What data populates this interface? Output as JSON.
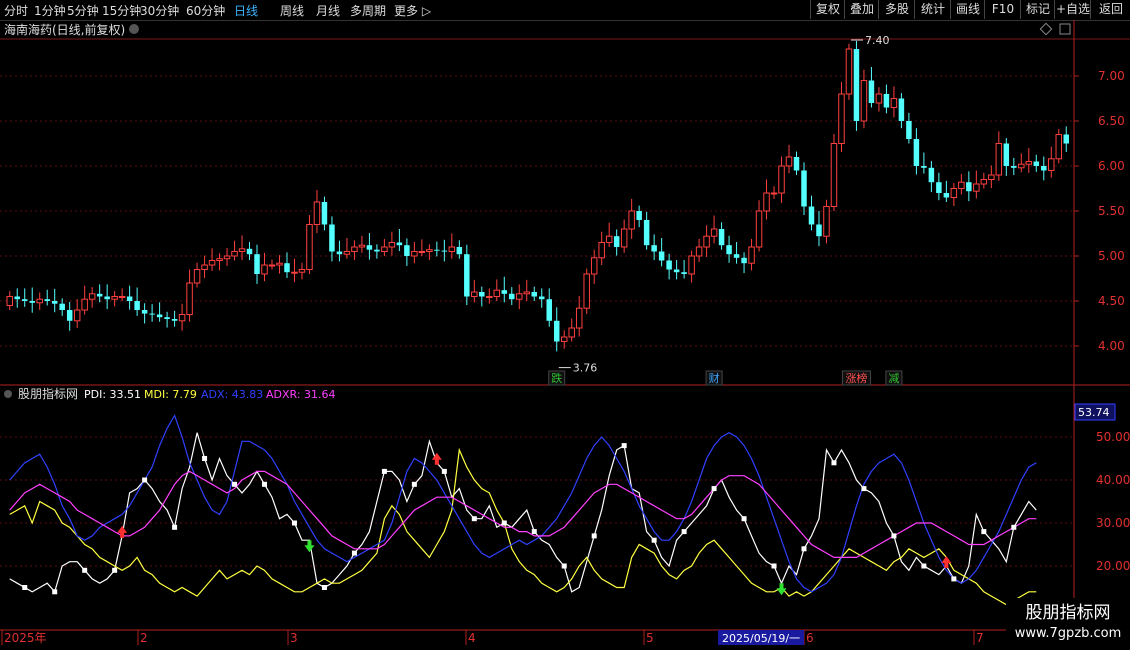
{
  "toolbar": {
    "periods": [
      "分时",
      "1分钟",
      "5分钟",
      "15分钟",
      "30分钟",
      "60分钟",
      "日线",
      "周线",
      "月线",
      "多周期",
      "更多"
    ],
    "active_period": "日线",
    "right_buttons": [
      "复权",
      "叠加",
      "多股",
      "统计",
      "画线",
      "F10",
      "标记",
      "+自选",
      "返回"
    ]
  },
  "price_panel": {
    "title": "海南海药(日线,前复权)",
    "high_label": "7.40",
    "low_label": "3.76",
    "event_tags": [
      {
        "text": "跌",
        "color": "#30c030"
      },
      {
        "text": "财",
        "color": "#3da5ff"
      },
      {
        "text": "涨榜",
        "color": "#ff5050"
      },
      {
        "text": "减",
        "color": "#30c030"
      }
    ],
    "y_ticks": [
      "7.00",
      "6.50",
      "6.00",
      "5.50",
      "5.00",
      "4.50",
      "4.00"
    ],
    "colors": {
      "up": "#ff4040",
      "down": "#54ffff",
      "grid": "#7a1a1a"
    }
  },
  "indicator_panel": {
    "title": "股朋指标网",
    "legend": [
      {
        "text": "PDI: 33.51",
        "color": "#ffffff"
      },
      {
        "text": "MDI: 7.79",
        "color": "#ffff40"
      },
      {
        "text": "ADX: 43.83",
        "color": "#3040ff"
      },
      {
        "text": "ADXR: 31.64",
        "color": "#ff40ff"
      }
    ],
    "y_ticks": [
      "50.00",
      "40.00",
      "30.00",
      "20.00"
    ],
    "current_value": "53.74"
  },
  "date_axis": {
    "labels": [
      "2025年",
      "2",
      "3",
      "4",
      "5",
      "6",
      "7"
    ],
    "cursor_date": "2025/05/19/一"
  },
  "watermark": {
    "title": "股朋指标网",
    "url": "www.7gpzb.com"
  },
  "chart_data": [
    {
      "type": "candlestick",
      "title": "海南海药(日线,前复权)",
      "ylim": [
        3.6,
        7.7
      ],
      "y_ticks": [
        4.0,
        4.5,
        5.0,
        5.5,
        6.0,
        6.5,
        7.0
      ],
      "annotations": [
        {
          "text": "7.40",
          "value": 7.4
        },
        {
          "text": "3.76",
          "value": 3.76
        }
      ],
      "close": [
        4.55,
        4.52,
        4.5,
        4.48,
        4.52,
        4.5,
        4.47,
        4.4,
        4.28,
        4.4,
        4.52,
        4.58,
        4.55,
        4.52,
        4.55,
        4.55,
        4.5,
        4.4,
        4.36,
        4.35,
        4.32,
        4.3,
        4.28,
        4.35,
        4.7,
        4.85,
        4.9,
        4.95,
        4.97,
        5.0,
        5.05,
        5.08,
        5.02,
        4.8,
        4.9,
        4.9,
        4.92,
        4.82,
        4.82,
        4.85,
        5.35,
        5.6,
        5.35,
        5.05,
        5.02,
        5.05,
        5.1,
        5.12,
        5.07,
        5.05,
        5.1,
        5.15,
        5.12,
        5.0,
        5.05,
        5.05,
        5.07,
        5.06,
        5.05,
        5.1,
        5.02,
        4.55,
        4.6,
        4.55,
        4.55,
        4.62,
        4.58,
        4.52,
        4.58,
        4.6,
        4.55,
        4.52,
        4.28,
        4.05,
        4.1,
        4.2,
        4.42,
        4.8,
        4.98,
        5.15,
        5.22,
        5.1,
        5.3,
        5.5,
        5.4,
        5.12,
        5.05,
        4.95,
        4.85,
        4.82,
        4.8,
        5.0,
        5.1,
        5.22,
        5.3,
        5.12,
        5.02,
        4.98,
        4.92,
        5.1,
        5.5,
        5.7,
        5.7,
        6.0,
        6.1,
        5.95,
        5.55,
        5.35,
        5.22,
        5.55,
        6.25,
        6.8,
        7.3,
        6.5,
        6.95,
        6.7,
        6.8,
        6.65,
        6.75,
        6.5,
        6.3,
        6.0,
        5.98,
        5.82,
        5.7,
        5.65,
        5.75,
        5.82,
        5.72,
        5.8,
        5.85,
        5.9,
        6.25,
        6.0,
        5.98,
        6.02,
        6.05,
        6.0,
        5.95,
        6.08,
        6.35,
        6.25
      ],
      "open": [
        4.45,
        4.55,
        4.52,
        4.5,
        4.48,
        4.52,
        4.5,
        4.47,
        4.4,
        4.28,
        4.4,
        4.52,
        4.58,
        4.55,
        4.52,
        4.55,
        4.55,
        4.5,
        4.4,
        4.36,
        4.35,
        4.32,
        4.3,
        4.28,
        4.35,
        4.7,
        4.85,
        4.9,
        4.95,
        4.97,
        5.0,
        5.05,
        5.08,
        5.02,
        4.8,
        4.9,
        4.9,
        4.92,
        4.82,
        4.82,
        4.85,
        5.35,
        5.6,
        5.35,
        5.05,
        5.02,
        5.05,
        5.1,
        5.12,
        5.07,
        5.05,
        5.1,
        5.15,
        5.12,
        5.0,
        5.05,
        5.05,
        5.07,
        5.06,
        5.05,
        5.1,
        5.02,
        4.55,
        4.6,
        4.55,
        4.55,
        4.62,
        4.58,
        4.52,
        4.58,
        4.6,
        4.55,
        4.52,
        4.28,
        4.05,
        4.1,
        4.2,
        4.42,
        4.8,
        4.98,
        5.15,
        5.22,
        5.1,
        5.3,
        5.5,
        5.4,
        5.12,
        5.05,
        4.95,
        4.85,
        4.82,
        4.8,
        5.0,
        5.1,
        5.22,
        5.3,
        5.12,
        5.02,
        4.98,
        4.92,
        5.1,
        5.5,
        5.7,
        5.7,
        6.0,
        6.1,
        5.95,
        5.55,
        5.35,
        5.22,
        5.55,
        6.25,
        6.8,
        7.3,
        6.5,
        6.95,
        6.7,
        6.8,
        6.65,
        6.75,
        6.5,
        6.3,
        6.0,
        5.98,
        5.82,
        5.7,
        5.65,
        5.75,
        5.82,
        5.72,
        5.8,
        5.85,
        5.9,
        6.25,
        6.0,
        5.98,
        6.02,
        6.05,
        6.0,
        5.95,
        6.08,
        6.35
      ]
    },
    {
      "type": "line",
      "title": "股朋指标网",
      "ylim": [
        12,
        60
      ],
      "y_ticks": [
        20,
        30,
        40,
        50
      ],
      "series": [
        {
          "name": "PDI",
          "color": "#ffffff",
          "values": [
            17,
            16,
            15,
            14,
            15,
            16,
            14,
            20,
            21,
            21,
            19,
            17,
            16,
            17,
            19,
            27,
            37,
            38,
            40,
            38,
            35,
            33,
            29,
            38,
            43,
            51,
            45,
            40,
            45,
            41,
            39,
            37,
            39,
            42,
            39,
            36,
            31,
            32,
            30,
            26,
            26,
            16,
            15,
            16,
            18,
            20,
            23,
            25,
            28,
            35,
            42,
            42,
            40,
            35,
            39,
            41,
            49,
            44,
            42,
            36,
            38,
            33,
            31,
            31,
            34,
            29,
            30,
            29,
            31,
            33,
            28,
            26,
            25,
            22,
            20,
            14,
            15,
            21,
            27,
            33,
            41,
            47,
            48,
            38,
            37,
            28,
            26,
            22,
            20,
            26,
            28,
            30,
            32,
            34,
            38,
            40,
            36,
            33,
            31,
            27,
            23,
            21,
            20,
            16,
            20,
            18,
            24,
            27,
            31,
            47,
            44,
            47,
            44,
            40,
            38,
            37,
            35,
            30,
            27,
            21,
            19,
            22,
            20,
            19,
            18,
            20,
            17,
            16,
            20,
            32,
            28,
            26,
            24,
            21,
            29,
            32,
            35,
            33
          ]
        },
        {
          "name": "MDI",
          "color": "#ffff40",
          "values": [
            32,
            33,
            34,
            30,
            35,
            34,
            33,
            30,
            29,
            27,
            25,
            24,
            22,
            21,
            20,
            19,
            20,
            22,
            19,
            18,
            16,
            15,
            14,
            15,
            14,
            13,
            15,
            17,
            19,
            17,
            18,
            19,
            18,
            20,
            19,
            17,
            16,
            15,
            14,
            14,
            15,
            16,
            17,
            16,
            16,
            17,
            18,
            19,
            21,
            23,
            31,
            34,
            32,
            28,
            26,
            24,
            22,
            25,
            28,
            33,
            47,
            43,
            40,
            38,
            37,
            33,
            30,
            24,
            21,
            19,
            18,
            16,
            15,
            14,
            15,
            17,
            20,
            22,
            19,
            17,
            16,
            15,
            15,
            22,
            25,
            24,
            23,
            20,
            18,
            17,
            19,
            20,
            23,
            25,
            26,
            24,
            22,
            20,
            18,
            16,
            15,
            14,
            14,
            15,
            13,
            14,
            13,
            14,
            16,
            18,
            20,
            22,
            24,
            23,
            22,
            21,
            20,
            19,
            21,
            22,
            24,
            23,
            22,
            23,
            24,
            22,
            19,
            18,
            17,
            16,
            14,
            13,
            12,
            11,
            12,
            13,
            14,
            14
          ]
        },
        {
          "name": "ADX",
          "color": "#3040ff",
          "values": [
            40,
            42,
            44,
            45,
            46,
            43,
            39,
            34,
            31,
            27,
            26,
            27,
            29,
            30,
            31,
            32,
            34,
            37,
            40,
            43,
            48,
            52,
            55,
            50,
            44,
            40,
            36,
            33,
            32,
            35,
            42,
            49,
            49,
            48,
            47,
            45,
            42,
            39,
            35,
            32,
            29,
            26,
            24,
            23,
            22,
            21,
            22,
            23,
            24,
            25,
            26,
            30,
            36,
            42,
            45,
            44,
            42,
            40,
            37,
            34,
            31,
            28,
            25,
            23,
            22,
            23,
            24,
            25,
            26,
            25,
            26,
            27,
            29,
            31,
            34,
            37,
            41,
            45,
            48,
            50,
            48,
            45,
            42,
            38,
            34,
            31,
            28,
            26,
            26,
            28,
            31,
            35,
            40,
            45,
            48,
            50,
            51,
            50,
            48,
            45,
            41,
            36,
            31,
            26,
            21,
            17,
            15,
            14,
            15,
            16,
            18,
            22,
            28,
            34,
            39,
            42,
            44,
            45,
            46,
            44,
            40,
            35,
            30,
            26,
            22,
            19,
            17,
            16,
            17,
            19,
            22,
            25,
            28,
            32,
            36,
            40,
            43,
            44
          ]
        },
        {
          "name": "ADXR",
          "color": "#ff40ff",
          "values": [
            33,
            35,
            37,
            38,
            39,
            38,
            37,
            36,
            35,
            33,
            32,
            31,
            30,
            29,
            28,
            27,
            27,
            28,
            29,
            31,
            33,
            36,
            39,
            41,
            42,
            41,
            40,
            39,
            38,
            37,
            38,
            40,
            41,
            42,
            42,
            41,
            40,
            39,
            37,
            35,
            33,
            31,
            29,
            27,
            26,
            25,
            24,
            24,
            24,
            24,
            25,
            27,
            29,
            31,
            33,
            34,
            35,
            36,
            36,
            36,
            35,
            34,
            33,
            32,
            31,
            30,
            29,
            29,
            28,
            28,
            27,
            27,
            27,
            28,
            29,
            31,
            33,
            35,
            37,
            38,
            39,
            39,
            38,
            37,
            36,
            35,
            34,
            33,
            32,
            31,
            31,
            32,
            34,
            36,
            38,
            40,
            41,
            41,
            41,
            40,
            39,
            37,
            35,
            33,
            31,
            29,
            27,
            25,
            24,
            23,
            22,
            22,
            22,
            22,
            23,
            24,
            25,
            26,
            27,
            28,
            29,
            30,
            30,
            30,
            29,
            28,
            27,
            26,
            25,
            25,
            25,
            26,
            27,
            28,
            29,
            30,
            31,
            31
          ]
        }
      ],
      "markers": [
        {
          "type": "up-arrow",
          "color": "#ff3030",
          "index": 15
        },
        {
          "type": "down-arrow",
          "color": "#30e030",
          "index": 40
        },
        {
          "type": "up-arrow",
          "color": "#ff3030",
          "index": 57
        },
        {
          "type": "down-arrow",
          "color": "#30e030",
          "index": 103
        },
        {
          "type": "up-arrow",
          "color": "#ff3030",
          "index": 125
        }
      ]
    }
  ]
}
